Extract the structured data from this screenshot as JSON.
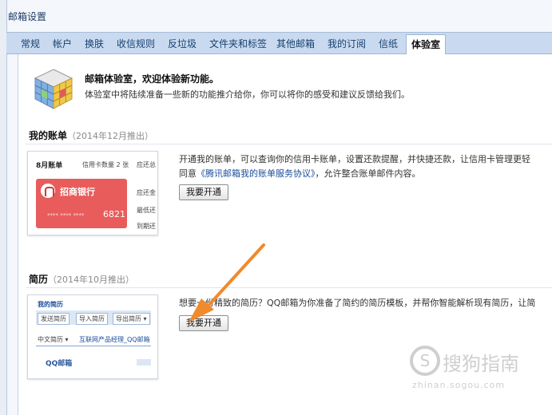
{
  "app": {
    "title": "邮箱设置"
  },
  "tabs": [
    {
      "label": "常规"
    },
    {
      "label": "帐户"
    },
    {
      "label": "换肤"
    },
    {
      "label": "收信规则"
    },
    {
      "label": "反垃圾"
    },
    {
      "label": "文件夹和标签"
    },
    {
      "label": "其他邮箱"
    },
    {
      "label": "我的订阅"
    },
    {
      "label": "信纸"
    },
    {
      "label": "体验室"
    }
  ],
  "intro": {
    "title": "邮箱体验室，欢迎体验新功能。",
    "description": "体验室中将陆续准备一些新的功能推介给你，你可以将你的感受和建议反馈给我们。"
  },
  "features": [
    {
      "title": "我的账单",
      "date": "（2014年12月推出）",
      "desc_line1": "开通我的账单，可以查询你的信用卡账单，设置还款提醒，并快捷还款，让信用卡管理更轻",
      "desc_line2_prefix": "同意",
      "desc_line2_link": "《腾讯邮箱我的账单服务协议》",
      "desc_line2_suffix": "，允许整合账单邮件内容。",
      "button": "我要开通",
      "thumb": {
        "month": "8月账单",
        "count_label": "信用卡数量 2 张",
        "due": "应还总",
        "bank": "招商银行",
        "card_number": "**** **** ****",
        "card_last4": "6821",
        "side1": "应还金",
        "side2": "最低还",
        "side3": "到期还"
      }
    },
    {
      "title": "简历",
      "date": "（2014年10月推出）",
      "desc_line1": "想要一份精致的简历？QQ邮箱为你准备了简约的简历模板，并帮你智能解析现有简历，让简",
      "button": "我要开通",
      "thumb": {
        "heading": "我的简历",
        "btn1": "发送简历",
        "btn2": "导入简历",
        "btn3": "导出简历 ▾",
        "lang": "中文简历 ▾",
        "resume_name": "互联网产品经理_QQ邮箱",
        "footer": "QQ邮箱"
      }
    }
  ],
  "watermark": {
    "brand": "搜狗指南",
    "url": "zhinan.sogou.com"
  }
}
